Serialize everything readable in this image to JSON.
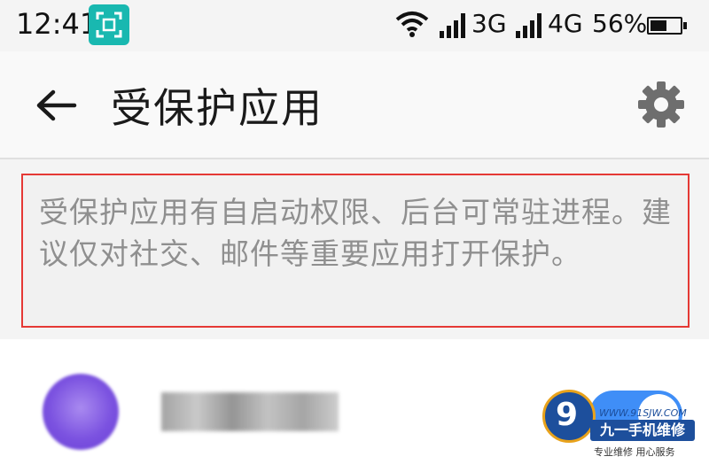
{
  "status_bar": {
    "time": "12:41",
    "network_3g": "3G",
    "network_4g": "4G",
    "battery_text": "56%",
    "battery_level": 0.56,
    "icons": [
      "screenshot-badge-icon",
      "wifi-icon",
      "signal-icon",
      "signal-icon",
      "battery-icon"
    ]
  },
  "app_bar": {
    "title": "受保护应用",
    "icons": [
      "back-arrow-icon",
      "gear-icon"
    ]
  },
  "notice": {
    "text": "受保护应用有自启动权限、后台可常驻进程。建议仅对社交、邮件等重要应用打开保护。"
  },
  "app_list": {
    "items": [
      {
        "toggle_on": true
      }
    ]
  },
  "watermark": {
    "logo": "9",
    "url": "WWW.91SJW.COM",
    "brand": "九一手机维修",
    "slogan": "专业维修 用心服务"
  },
  "colors": {
    "accent_blue": "#3f8ef7",
    "highlight_red": "#e53935",
    "badge_teal": "#19b8b0"
  }
}
